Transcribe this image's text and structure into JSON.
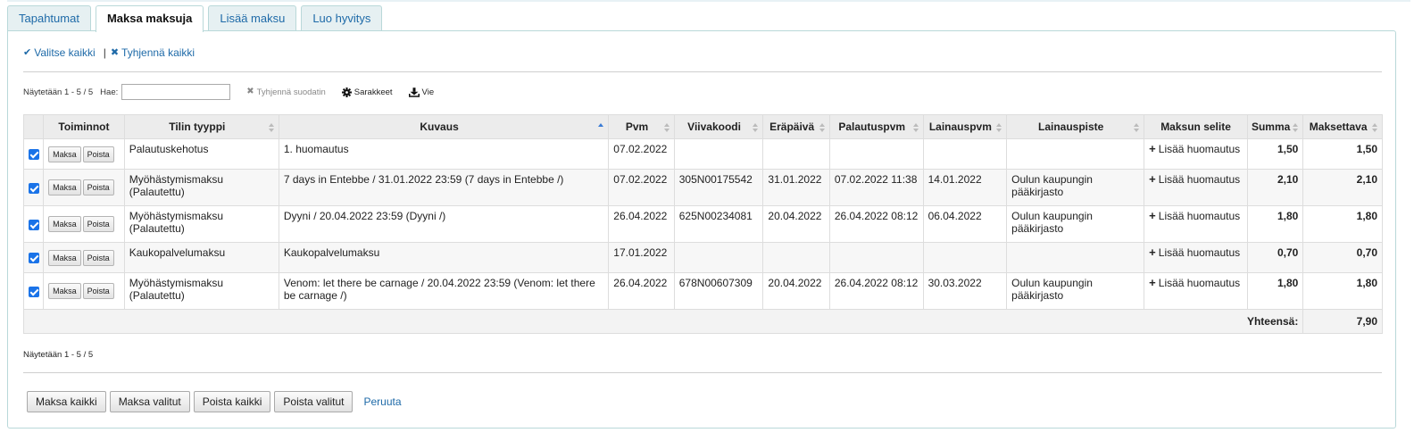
{
  "tabs": [
    "Tapahtumat",
    "Maksa maksuja",
    "Lisää maksu",
    "Luo hyvitys"
  ],
  "active_tab": 1,
  "select_all": "Valitse kaikki",
  "clear_all": "Tyhjennä kaikki",
  "info_top": "Näytetään 1 - 5 / 5",
  "search_label": "Hae:",
  "search_value": "",
  "clear_filter": "Tyhjennä suodatin",
  "columns_label": "Sarakkeet",
  "export_label": "Vie",
  "headers": [
    "Toiminnot",
    "Tilin tyyppi",
    "Kuvaus",
    "Pvm",
    "Viivakoodi",
    "Eräpäivä",
    "Palautuspvm",
    "Lainauspvm",
    "Lainauspiste",
    "Maksun selite",
    "Summa",
    "Maksettava"
  ],
  "pay_btn": "Maksa",
  "remove_btn": "Poista",
  "add_note": "Lisää huomautus",
  "rows": [
    {
      "type": "Palautuskehotus",
      "desc": "1. huomautus",
      "date": "07.02.2022",
      "barcode": "",
      "due": "",
      "returned": "",
      "issued": "",
      "branch": "",
      "amount": "1,50",
      "outstanding": "1,50"
    },
    {
      "type": "Myöhästymismaksu (Palautettu)",
      "desc": "7 days in Entebbe / 31.01.2022 23:59 (7 days in Entebbe /)",
      "date": "07.02.2022",
      "barcode": "305N00175542",
      "due": "31.01.2022",
      "returned": "07.02.2022 11:38",
      "issued": "14.01.2022",
      "branch": "Oulun kaupungin pääkirjasto",
      "amount": "2,10",
      "outstanding": "2,10"
    },
    {
      "type": "Myöhästymismaksu (Palautettu)",
      "desc": "Dyyni / 20.04.2022 23:59 (Dyyni /)",
      "date": "26.04.2022",
      "barcode": "625N00234081",
      "due": "20.04.2022",
      "returned": "26.04.2022 08:12",
      "issued": "06.04.2022",
      "branch": "Oulun kaupungin pääkirjasto",
      "amount": "1,80",
      "outstanding": "1,80"
    },
    {
      "type": "Kaukopalvelumaksu",
      "desc": "Kaukopalvelumaksu",
      "date": "17.01.2022",
      "barcode": "",
      "due": "",
      "returned": "",
      "issued": "",
      "branch": "",
      "amount": "0,70",
      "outstanding": "0,70"
    },
    {
      "type": "Myöhästymismaksu (Palautettu)",
      "desc": "Venom: let there be carnage / 20.04.2022 23:59 (Venom: let there be carnage /)",
      "date": "26.04.2022",
      "barcode": "678N00607309",
      "due": "20.04.2022",
      "returned": "26.04.2022 08:12",
      "issued": "30.03.2022",
      "branch": "Oulun kaupungin pääkirjasto",
      "amount": "1,80",
      "outstanding": "1,80"
    }
  ],
  "total_label": "Yhteensä:",
  "total_value": "7,90",
  "info_bottom": "Näytetään 1 - 5 / 5",
  "buttons": [
    "Maksa kaikki",
    "Maksa valitut",
    "Poista kaikki",
    "Poista valitut"
  ],
  "cancel": "Peruuta",
  "icons": {
    "check": "check-icon",
    "clear": "times-icon",
    "filter_clear": "times-icon",
    "columns": "gear-icon",
    "export": "download-icon",
    "add": "plus-icon"
  },
  "colors": {
    "link": "#1e6aa8",
    "amount": "#c00000",
    "checkbox": "#1a73e8"
  }
}
